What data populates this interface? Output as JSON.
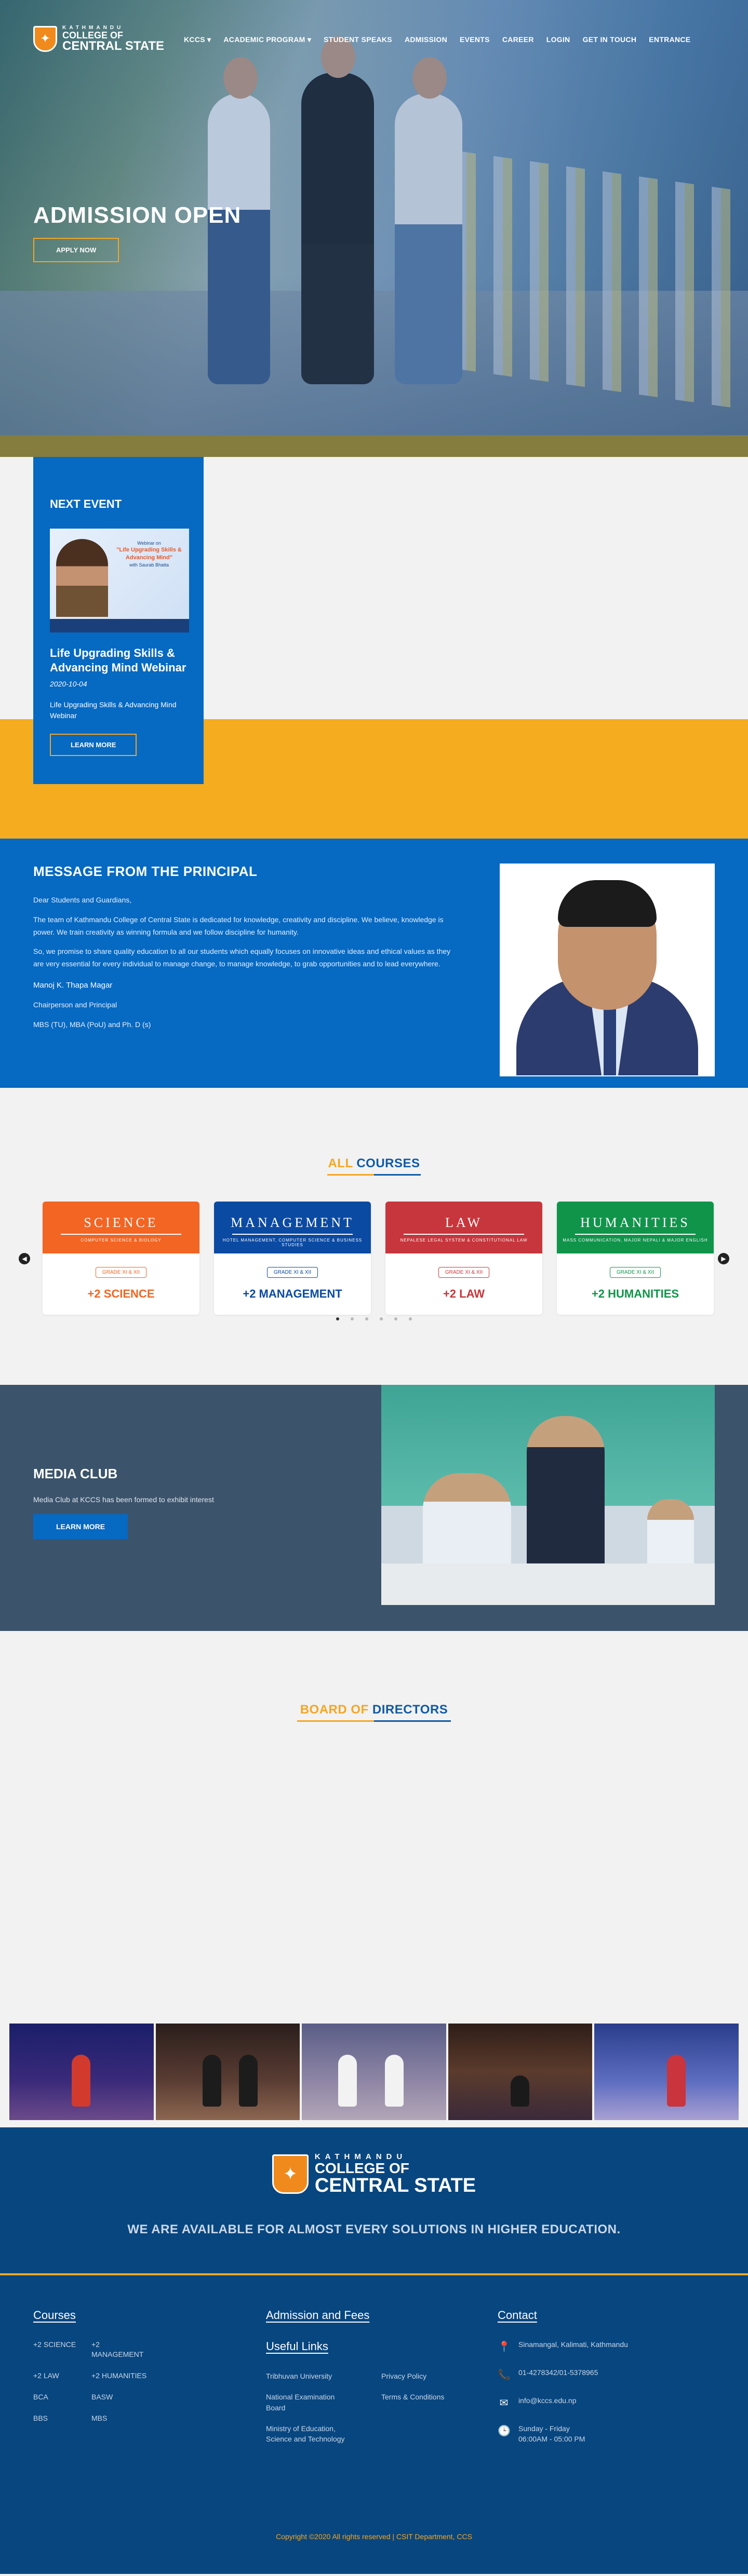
{
  "brand": {
    "small": "KATHMANDU",
    "line1": "COLLEGE OF",
    "line2": "CENTRAL STATE",
    "shield_icon": "✦"
  },
  "nav": [
    {
      "label": "KCCS ▾"
    },
    {
      "label": "ACADEMIC PROGRAM ▾"
    },
    {
      "label": "STUDENT SPEAKS"
    },
    {
      "label": "ADMISSION"
    },
    {
      "label": "EVENTS"
    },
    {
      "label": "CAREER"
    },
    {
      "label": "LOGIN"
    },
    {
      "label": "GET IN TOUCH"
    },
    {
      "label": "ENTRANCE"
    }
  ],
  "hero": {
    "title": "ADMISSION OPEN",
    "button": "APPLY NOW"
  },
  "event": {
    "heading": "NEXT EVENT",
    "image_text_1": "Webinar on",
    "image_text_2": "\"Life Upgrading Skills & Advancing Mind\"",
    "image_text_3": "with Saurab Bhatta",
    "title": "Life Upgrading Skills & Advancing Mind Webinar",
    "date": "2020-10-04",
    "description": "Life Upgrading Skills & Advancing Mind Webinar",
    "button": "LEARN MORE"
  },
  "principal": {
    "heading": "MESSAGE FROM THE PRINCIPAL",
    "salutation": "Dear Students and Guardians,",
    "para1": "The team of Kathmandu College of Central State is dedicated for knowledge, creativity and discipline. We believe, knowledge is power. We train creativity as winning formula and we follow discipline for humanity.",
    "para2": "So, we promise to share quality education to all our students which equally focuses on innovative ideas and ethical values as they are very essential for every individual to manage change, to manage knowledge, to grab opportunities and to lead everywhere.",
    "name": "Manoj K. Thapa Magar",
    "role": "Chairperson and Principal",
    "degrees": "MBS (TU), MBA (PoU) and Ph. D (s)"
  },
  "courses": {
    "title_a": "ALL",
    "title_b": "COURSES",
    "prev_icon": "◀",
    "next_icon": "▶",
    "items": [
      {
        "head": "SCIENCE",
        "sub": "COMPUTER SCIENCE & BIOLOGY",
        "grade": "GRADE XI & XII",
        "name": "+2 SCIENCE",
        "color": "#f26522"
      },
      {
        "head": "MANAGEMENT",
        "sub": "HOTEL MANAGEMENT, COMPUTER SCIENCE & BUSINESS STUDIES",
        "grade": "GRADE XI & XII",
        "name": "+2 MANAGEMENT",
        "color": "#0b4aa2"
      },
      {
        "head": "LAW",
        "sub": "NEPALESE LEGAL SYSTEM & CONSTITUTIONAL LAW",
        "grade": "GRADE XI & XII",
        "name": "+2 LAW",
        "color": "#c7363c"
      },
      {
        "head": "HUMANITIES",
        "sub": "MASS COMMUNICATION, MAJOR NEPALI & MAJOR ENGLISH",
        "grade": "GRADE XI & XII",
        "name": "+2 HUMANITIES",
        "color": "#10944a"
      }
    ]
  },
  "media": {
    "heading": "MEDIA CLUB",
    "text": "Media Club at KCCS has been formed to exhibit interest",
    "button": "LEARN MORE"
  },
  "board": {
    "title_a": "BOARD OF",
    "title_b": "DIRECTORS"
  },
  "footer": {
    "tagline": "WE ARE AVAILABLE FOR ALMOST EVERY SOLUTIONS IN HIGHER EDUCATION.",
    "courses_heading": "Courses",
    "courses": [
      "+2 SCIENCE",
      "+2 MANAGEMENT",
      "+2 LAW",
      "+2 HUMANITIES",
      "BCA",
      "BASW",
      "BBS",
      "MBS"
    ],
    "admission_heading": "Admission and Fees",
    "useful_heading": "Useful Links",
    "useful": [
      "Tribhuvan University",
      "Privacy Policy",
      "National Examination Board",
      "Terms & Conditions",
      "Ministry of Education, Science and Technology"
    ],
    "contact_heading": "Contact",
    "contact": [
      {
        "icon": "map-pin-icon",
        "glyph": "📍",
        "text": "Sinamangal, Kalimati, Kathmandu"
      },
      {
        "icon": "phone-icon",
        "glyph": "📞",
        "text": "01-4278342/01-5378965"
      },
      {
        "icon": "mail-icon",
        "glyph": "✉",
        "text": "info@kccs.edu.np"
      },
      {
        "icon": "clock-icon",
        "glyph": "🕒",
        "text": "Sunday - Friday\n06:00AM - 05:00 PM"
      }
    ],
    "copyright": "Copyright ©2020 All rights reserved | CSIT Department, CCS"
  },
  "colors": {
    "primary": "#0669c2",
    "accent": "#f5a623",
    "footer": "#08467f"
  }
}
